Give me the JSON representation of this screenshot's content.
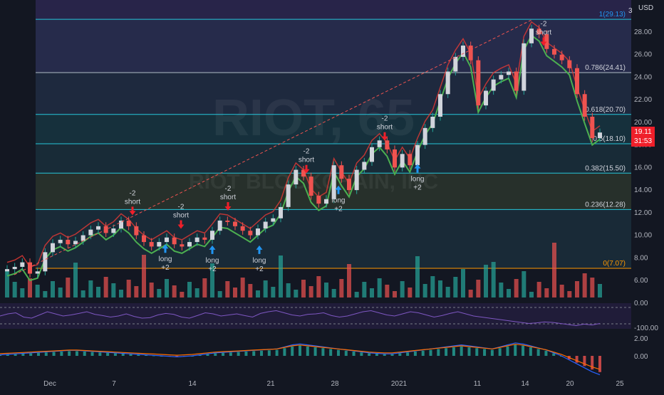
{
  "toolbar": {
    "currency": "USD",
    "corner_label": "3"
  },
  "watermark": {
    "symbol": "RIOT, 65",
    "name": "RIOT BLOCKCHAIN, INC"
  },
  "price_badge": {
    "price": "19.11",
    "countdown": "31:53"
  },
  "colors": {
    "background": "#131722",
    "up": "#26a69a",
    "down": "#ef5350",
    "fib_line": "#2196f3",
    "short_arrow": "#ef1f2a",
    "long_arrow": "#2196f3",
    "ema_green": "#4caf50",
    "ema_red": "#e53935"
  },
  "chart_data": [
    {
      "type": "line",
      "title": "",
      "x_ticks": [
        "Dec",
        "7",
        "14",
        "21",
        "28",
        "2021",
        "11",
        "14",
        "20",
        "25"
      ],
      "y_ticks": [
        "6.00",
        "8.00",
        "10.00",
        "12.00",
        "14.00",
        "16.00",
        "18.00",
        "20.00",
        "22.00",
        "24.00",
        "26.00",
        "28.00"
      ],
      "ylim": [
        3.5,
        30.0
      ],
      "series": [
        {
          "values": [
            7.0,
            7.2,
            7.6,
            6.6,
            6.8,
            8.5,
            9.3,
            9.6,
            9.2,
            9.5,
            10.0,
            10.5,
            10.8,
            10.2,
            10.6,
            11.3,
            10.8,
            10.0,
            9.4,
            9.0,
            9.4,
            9.8,
            9.2,
            9.0,
            9.4,
            9.8,
            9.6,
            10.4,
            11.3,
            11.2,
            10.8,
            10.4,
            10.0,
            10.6,
            11.2,
            11.5,
            12.5,
            14.5,
            15.8,
            15.2,
            13.5,
            12.8,
            13.2,
            16.2,
            15.0,
            14.0,
            15.8,
            16.5,
            17.8,
            18.4,
            17.6,
            16.0,
            17.2,
            16.2,
            18.0,
            19.5,
            20.5,
            22.5,
            24.5,
            25.8,
            26.8,
            25.5,
            21.5,
            22.8,
            23.8,
            24.2,
            24.5,
            22.8,
            27.0,
            28.3,
            27.8,
            26.5,
            26.0,
            25.5,
            24.8,
            22.5,
            20.5,
            18.6,
            19.1
          ]
        }
      ],
      "fib_levels": [
        {
          "ratio": "1",
          "price": 29.13,
          "label": "1(29.13)"
        },
        {
          "ratio": "0.786",
          "price": 24.41,
          "label": "0.786(24.41)"
        },
        {
          "ratio": "0.618",
          "price": 20.7,
          "label": "0.618(20.70)"
        },
        {
          "ratio": "0.5",
          "price": 18.1,
          "label": "0.5(18.10)"
        },
        {
          "ratio": "0.382",
          "price": 15.5,
          "label": "0.382(15.50)"
        },
        {
          "ratio": "0.236",
          "price": 12.28,
          "label": "0.236(12.28)"
        },
        {
          "ratio": "0",
          "price": 7.07,
          "label": "0(7.07)"
        }
      ],
      "trendline": {
        "from": [
          6.8,
          6.5
        ],
        "to": [
          29.13,
          29.13
        ]
      },
      "signals": [
        {
          "kind": "short",
          "text": [
            "-2",
            "short"
          ],
          "price": 11.9
        },
        {
          "kind": "short",
          "text": [
            "-2",
            "short"
          ],
          "price": 10.7
        },
        {
          "kind": "short",
          "text": [
            "-2",
            "short"
          ],
          "price": 12.3
        },
        {
          "kind": "short",
          "text": [
            "-2",
            "short"
          ],
          "price": 15.6
        },
        {
          "kind": "short",
          "text": [
            "-2",
            "short"
          ],
          "price": 18.5
        },
        {
          "kind": "short",
          "text": [
            "-2",
            "short"
          ],
          "price": 26.9
        },
        {
          "kind": "long",
          "text": [
            "long",
            "+2"
          ],
          "price": 9.2
        },
        {
          "kind": "long",
          "text": [
            "long",
            "+2"
          ],
          "price": 9.1
        },
        {
          "kind": "long",
          "text": [
            "long",
            "+2"
          ],
          "price": 9.1
        },
        {
          "kind": "long",
          "text": [
            "long",
            "+2"
          ],
          "price": 14.4
        },
        {
          "kind": "long",
          "text": [
            "long",
            "+2"
          ],
          "price": 16.3
        }
      ]
    },
    {
      "type": "line",
      "title": "",
      "y_ticks": [
        "0.00",
        "-100.00"
      ],
      "ylim": [
        -110,
        10
      ],
      "series": [
        {
          "values": [
            -50,
            -40,
            -35,
            -55,
            -60,
            -45,
            -30,
            -40,
            -50,
            -45,
            -38,
            -30,
            -42,
            -48,
            -55,
            -50,
            -40,
            -52,
            -60,
            -58,
            -45,
            -38,
            -42,
            -55,
            -60,
            -48,
            -35,
            -40,
            -50,
            -45,
            -40,
            -48,
            -55,
            -38,
            -30,
            -25,
            -35,
            -45,
            -50,
            -42,
            -40,
            -35,
            -48,
            -55,
            -50,
            -40,
            -30,
            -25,
            -35,
            -45,
            -50,
            -40,
            -30,
            -35,
            -45,
            -55,
            -48,
            -38,
            -30,
            -40,
            -50,
            -55,
            -60,
            -65,
            -70,
            -75,
            -80,
            -85,
            -82,
            -78,
            -80,
            -85,
            -90,
            -95,
            -88,
            -92,
            -85
          ]
        }
      ]
    },
    {
      "type": "bar",
      "title": "",
      "y_ticks": [
        "2.00",
        "0.00"
      ],
      "ylim": [
        -2.0,
        3.0
      ],
      "series": [
        {
          "values": [
            0.1,
            0.15,
            0.2,
            0.25,
            0.3,
            0.35,
            0.4,
            0.45,
            0.5,
            0.55,
            0.55,
            0.5,
            0.45,
            0.4,
            0.35,
            0.3,
            0.25,
            0.2,
            0.15,
            0.1,
            0.05,
            0.0,
            -0.05,
            -0.1,
            -0.05,
            0.0,
            0.1,
            0.2,
            0.3,
            0.35,
            0.4,
            0.45,
            0.5,
            0.55,
            0.6,
            0.65,
            0.7,
            0.9,
            1.1,
            1.2,
            1.1,
            1.0,
            0.9,
            0.8,
            0.7,
            0.6,
            0.5,
            0.4,
            0.3,
            0.25,
            0.2,
            0.2,
            0.3,
            0.4,
            0.5,
            0.6,
            0.7,
            0.8,
            0.9,
            1.0,
            1.1,
            1.0,
            0.9,
            0.8,
            0.7,
            0.9,
            1.1,
            1.3,
            1.2,
            1.0,
            0.8,
            0.6,
            0.3,
            0.0,
            -0.4,
            -0.8,
            -1.2,
            -1.6,
            -1.9
          ]
        }
      ]
    }
  ]
}
